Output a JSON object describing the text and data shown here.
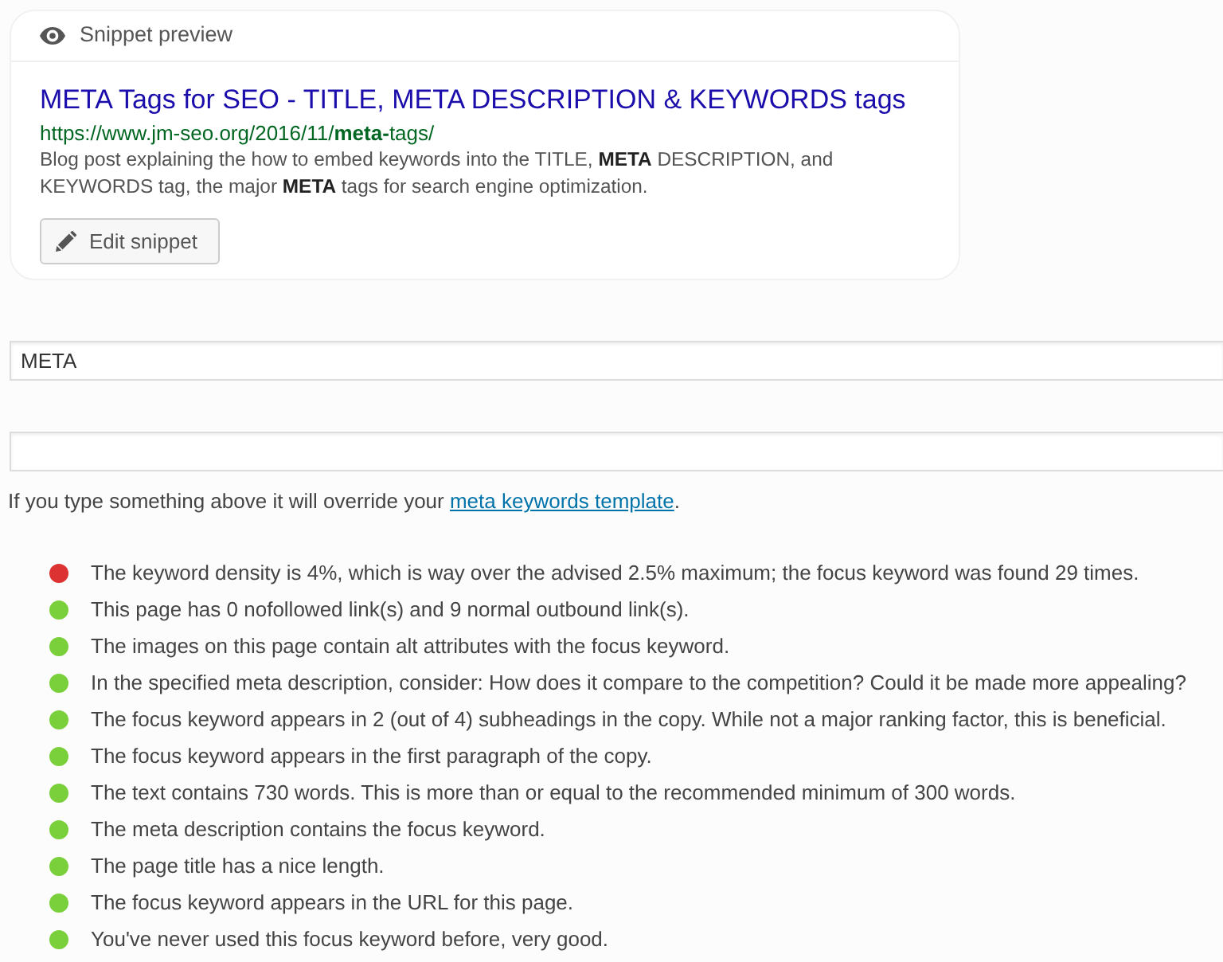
{
  "snippet_preview": {
    "heading": "Snippet preview",
    "title": "META Tags for SEO - TITLE, META DESCRIPTION & KEYWORDS tags",
    "url": "https://www.jm-seo.org/2016/11/**meta-**tags/",
    "description": "Blog post explaining the how to embed keywords into the TITLE, **META** DESCRIPTION, and KEYWORDS tag, the major **META** tags for search engine optimization.",
    "edit_button": "Edit snippet"
  },
  "focus_keyword_field": {
    "value": "META"
  },
  "meta_keywords_help": {
    "before": "If you type something above it will override your ",
    "link": "meta keywords template",
    "after": "."
  },
  "analysis": [
    {
      "text": "The keyword density is 4%, which is way over the advised 2.5% maximum; the focus keyword was found 29 times.",
      "color": "#dc3232"
    },
    {
      "text": "This page has 0 nofollowed link(s) and 9 normal outbound link(s).",
      "color": "#7ad03a"
    },
    {
      "text": "The images on this page contain alt attributes with the focus keyword.",
      "color": "#7ad03a"
    },
    {
      "text": "In the specified meta description, consider: How does it compare to the competition? Could it be made more appealing?",
      "color": "#7ad03a"
    },
    {
      "text": "The focus keyword appears in 2 (out of 4) subheadings in the copy. While not a major ranking factor, this is beneficial.",
      "color": "#7ad03a"
    },
    {
      "text": "The focus keyword appears in the first paragraph of the copy.",
      "color": "#7ad03a"
    },
    {
      "text": "The text contains 730 words. This is more than or equal to the recommended minimum of 300 words.",
      "color": "#7ad03a"
    },
    {
      "text": "The meta description contains the focus keyword.",
      "color": "#7ad03a"
    },
    {
      "text": "The page title has a nice length.",
      "color": "#7ad03a"
    },
    {
      "text": "The focus keyword appears in the URL for this page.",
      "color": "#7ad03a"
    },
    {
      "text": "You've never used this focus keyword before, very good.",
      "color": "#7ad03a"
    }
  ]
}
